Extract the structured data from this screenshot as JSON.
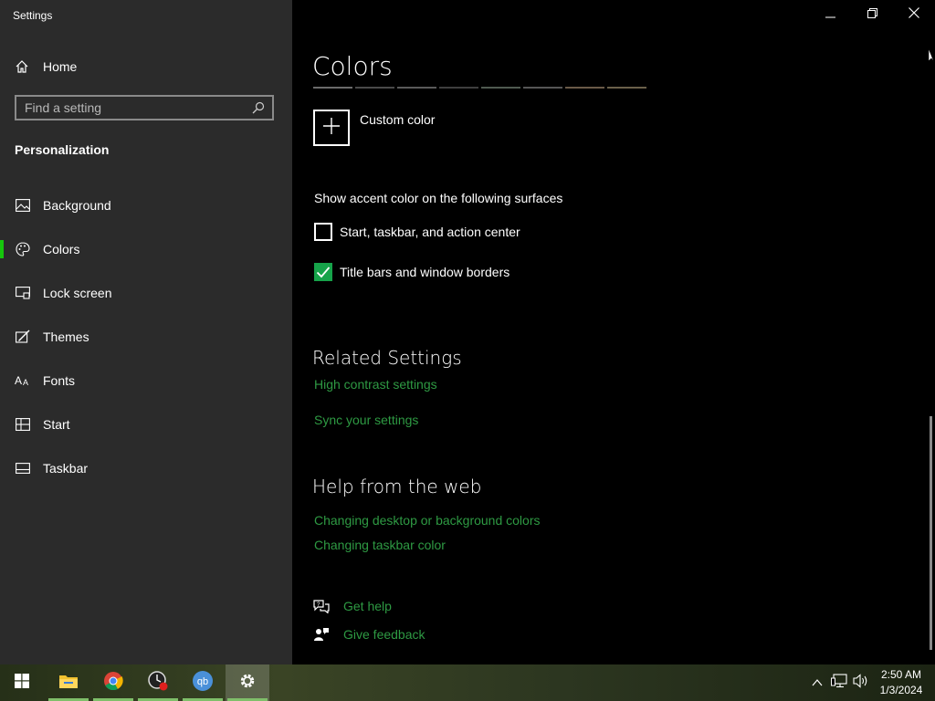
{
  "window": {
    "title": "Settings",
    "controls": [
      "minimize-icon",
      "restore-icon",
      "close-icon"
    ]
  },
  "sidebar": {
    "home_label": "Home",
    "search_placeholder": "Find a setting",
    "section_title": "Personalization",
    "items": [
      {
        "label": "Background",
        "icon": "background-icon"
      },
      {
        "label": "Colors",
        "icon": "palette-icon",
        "active": true
      },
      {
        "label": "Lock screen",
        "icon": "lock-screen-icon"
      },
      {
        "label": "Themes",
        "icon": "themes-icon"
      },
      {
        "label": "Fonts",
        "icon": "fonts-icon"
      },
      {
        "label": "Start",
        "icon": "start-icon"
      },
      {
        "label": "Taskbar",
        "icon": "taskbar-icon"
      }
    ]
  },
  "main": {
    "page_title": "Colors",
    "swatch_colors": [
      "#6b6b6b",
      "#4a4a4a",
      "#5a5a5a",
      "#3e3e3e",
      "#4f5a50",
      "#565656",
      "#6a5a48",
      "#6a604a"
    ],
    "custom_color_label": "Custom color",
    "accent_heading": "Show accent color on the following surfaces",
    "checkboxes": [
      {
        "label": "Start, taskbar, and action center",
        "checked": false
      },
      {
        "label": "Title bars and window borders",
        "checked": true
      }
    ],
    "related": {
      "heading": "Related Settings",
      "links": [
        "High contrast settings",
        "Sync your settings"
      ]
    },
    "help_web": {
      "heading": "Help from the web",
      "links": [
        "Changing desktop or background colors",
        "Changing taskbar color"
      ]
    },
    "help_links": [
      {
        "label": "Get help",
        "icon": "get-help-icon"
      },
      {
        "label": "Give feedback",
        "icon": "feedback-icon"
      }
    ]
  },
  "colors": {
    "accent": "#16c60c",
    "link": "#2e9a43",
    "checkbox_on": "#16a34a",
    "sidebar_bg": "#2b2b2b",
    "content_bg": "#000000"
  },
  "taskbar": {
    "apps": [
      {
        "name": "start-icon"
      },
      {
        "name": "file-explorer-icon",
        "running": true
      },
      {
        "name": "chrome-icon",
        "running": true
      },
      {
        "name": "clock-app-icon",
        "running": true
      },
      {
        "name": "qbittorrent-icon",
        "running": true
      },
      {
        "name": "settings-icon",
        "running": true,
        "active": true
      }
    ],
    "tray_icons": [
      "chevron-up-icon",
      "network-icon",
      "volume-icon"
    ],
    "time": "2:50 AM",
    "date": "1/3/2024"
  }
}
